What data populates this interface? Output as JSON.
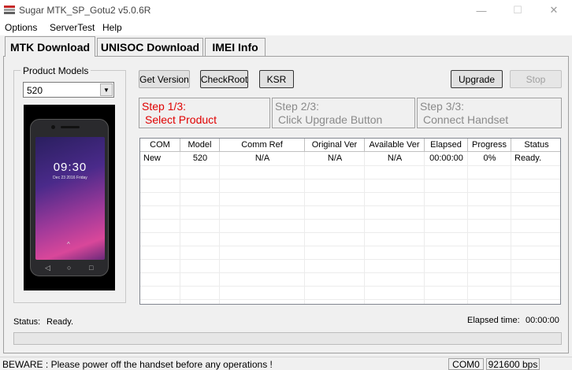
{
  "window": {
    "title": "Sugar MTK_SP_Gotu2 v5.0.6R",
    "controls": {
      "minimize": "—",
      "maximize": "☐",
      "close": "✕"
    }
  },
  "menu": [
    "Options",
    "ServerTest",
    "Help"
  ],
  "tabs": [
    {
      "label": "MTK Download",
      "active": true
    },
    {
      "label": "UNISOC Download",
      "active": false
    },
    {
      "label": "IMEI Info",
      "active": false
    }
  ],
  "product_models": {
    "label": "Product Models",
    "selected": "520",
    "phone_image": {
      "clock": "09:30",
      "date": "Dec 23 2016 Friday"
    }
  },
  "buttons": {
    "get_version": "Get Version",
    "check_root": "CheckRoot",
    "ksr": "KSR",
    "upgrade": "Upgrade",
    "stop": "Stop"
  },
  "steps": [
    {
      "title": "Step 1/3:",
      "desc": "Select Product",
      "active": true
    },
    {
      "title": "Step 2/3:",
      "desc": "Click Upgrade Button",
      "active": false
    },
    {
      "title": "Step 3/3:",
      "desc": "Connect Handset",
      "active": false
    }
  ],
  "table": {
    "columns": [
      "COM",
      "Model",
      "Comm Ref",
      "Original Ver",
      "Available Ver",
      "Elapsed",
      "Progress",
      "Status"
    ],
    "rows": [
      [
        "New",
        "520",
        "N/A",
        "N/A",
        "N/A",
        "00:00:00",
        "0%",
        "Ready."
      ]
    ]
  },
  "status": {
    "label": "Status:",
    "value": "Ready."
  },
  "elapsed": {
    "label": "Elapsed time:",
    "value": "00:00:00"
  },
  "progress": {
    "fraction": 0
  },
  "statusbar": {
    "message": "BEWARE : Please power off the handset before any operations !",
    "port": "COM0",
    "baud": "921600 bps"
  },
  "colors": {
    "step_active": "#e00000",
    "step_inactive": "#8a8a8a",
    "progress_fill": "#06b025"
  }
}
